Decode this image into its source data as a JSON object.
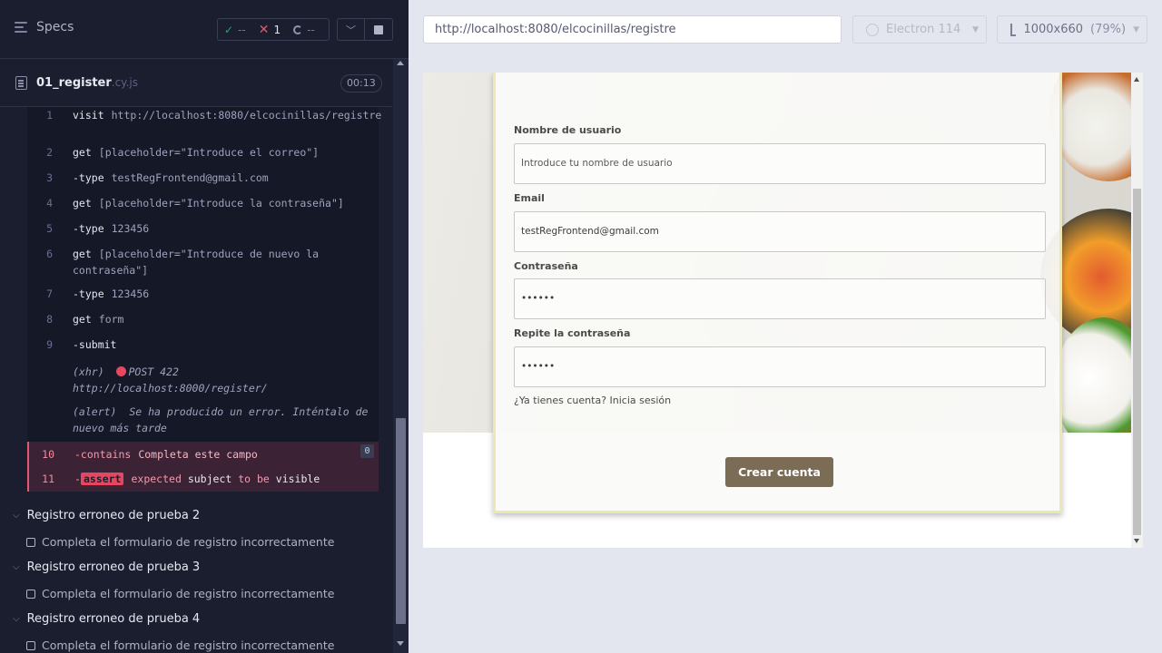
{
  "reporter": {
    "specs_label": "Specs",
    "stats": {
      "passed": "--",
      "failed": "1",
      "pending": "--"
    },
    "spec_file": {
      "name": "01_register",
      "ext": ".cy.js",
      "duration": "00:13"
    },
    "commands": [
      {
        "n": "1",
        "name": "visit",
        "message": "http://localhost:8080/elcocinillas/registre"
      },
      {
        "n": "2",
        "name": "get",
        "message": "[placeholder=\"Introduce el correo\"]"
      },
      {
        "n": "3",
        "name": "-type",
        "message": "testRegFrontend@gmail.com"
      },
      {
        "n": "4",
        "name": "get",
        "message": "[placeholder=\"Introduce la contraseña\"]"
      },
      {
        "n": "5",
        "name": "-type",
        "message": "123456"
      },
      {
        "n": "6",
        "name": "get",
        "message": "[placeholder=\"Introduce de nuevo la contraseña\"]"
      },
      {
        "n": "7",
        "name": "-type",
        "message": "123456"
      },
      {
        "n": "8",
        "name": "get",
        "message": "form"
      },
      {
        "n": "9",
        "name": "-submit",
        "message": ""
      }
    ],
    "xhr_log": {
      "tag": "(xhr)",
      "method": "POST 422",
      "url": "http://localhost:8000/register/"
    },
    "alert_log": {
      "tag": "(alert)",
      "text": "Se ha producido un error. Inténtalo de nuevo más tarde"
    },
    "failed_commands": [
      {
        "n": "10",
        "name": "-contains",
        "message": "Completa este campo",
        "badge": "0"
      },
      {
        "n": "11",
        "tag": "assert",
        "words": [
          "expected",
          "subject",
          "to be",
          "visible"
        ]
      }
    ],
    "suites": [
      {
        "title": "Registro erroneo de prueba 2",
        "test": "Completa el formulario de registro incorrectamente"
      },
      {
        "title": "Registro erroneo de prueba 3",
        "test": "Completa el formulario de registro incorrectamente"
      },
      {
        "title": "Registro erroneo de prueba 4",
        "test": "Completa el formulario de registro incorrectamente"
      }
    ]
  },
  "toolbar": {
    "url": "http://localhost:8080/elcocinillas/registre",
    "browser": "Electron 114",
    "viewport_size": "1000x660",
    "viewport_scale": "(79%)"
  },
  "form": {
    "username_label": "Nombre de usuario",
    "username_placeholder": "Introduce tu nombre de usuario",
    "email_label": "Email",
    "email_value": "testRegFrontend@gmail.com",
    "password_label": "Contraseña",
    "password_value": "••••••",
    "repeat_label": "Repite la contraseña",
    "repeat_value": "••••••",
    "login_link": "¿Ya tienes cuenta? Inicia sesión",
    "submit_label": "Crear cuenta"
  }
}
